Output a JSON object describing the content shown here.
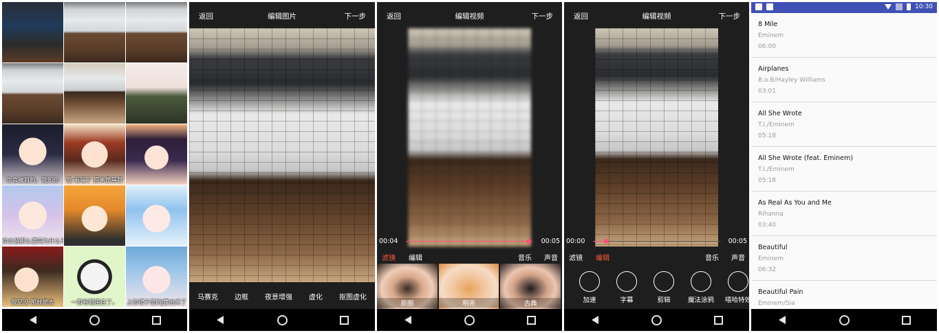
{
  "gallery": {
    "tiles": [
      {
        "style": "code",
        "caption": ""
      },
      {
        "style": "kb",
        "caption": ""
      },
      {
        "style": "kb",
        "caption": ""
      },
      {
        "style": "kb",
        "caption": ""
      },
      {
        "style": "kb2",
        "caption": ""
      },
      {
        "style": "soldiers",
        "caption": ""
      },
      {
        "style": "an-blue",
        "caption": "你会被目的，我知你 "
      },
      {
        "style": "an-red",
        "caption": "我 着福了 原来是基督"
      },
      {
        "style": "an-purple",
        "caption": ""
      },
      {
        "style": "an-pink",
        "caption": "你女装那么漂亮为什么不去"
      },
      {
        "style": "an-orange",
        "caption": ""
      },
      {
        "style": "an-rem",
        "caption": ""
      },
      {
        "style": "an-red2",
        "caption": "我见没 那就是去"
      },
      {
        "style": "panda",
        "caption": "一群智弱围住了。"
      },
      {
        "style": "an-blue2",
        "caption": "上你裙子里的j露出来了"
      }
    ]
  },
  "photo_editor": {
    "back": "返回",
    "title": "编辑图片",
    "next": "下一步",
    "tools": [
      "马赛克",
      "边框",
      "夜景增强",
      "虚化",
      "抠图虚化"
    ]
  },
  "video_filter": {
    "back": "返回",
    "title": "编辑视频",
    "next": "下一步",
    "time_current": "00:04",
    "time_total": "00:05",
    "progress": 0.96,
    "tabs": {
      "filter": "滤镜",
      "edit": "编辑",
      "music": "音乐",
      "sound": "声音"
    },
    "filters": [
      "原图",
      "明亮",
      "古典"
    ]
  },
  "video_edit": {
    "back": "返回",
    "title": "编辑视频",
    "next": "下一步",
    "time_current": "00:00",
    "time_total": "00:05",
    "progress": 0.1,
    "tabs": {
      "filter": "滤镜",
      "edit": "编辑",
      "music": "音乐",
      "sound": "声音"
    },
    "effects": [
      "加速",
      "字幕",
      "剪辑",
      "魔法涂鸦",
      "嘻哈特效"
    ]
  },
  "music_list": {
    "status_time": "10:30",
    "songs": [
      {
        "title": "8 Mile",
        "artist": "Eminem",
        "duration": "06:00"
      },
      {
        "title": "Airplanes",
        "artist": "B.o.B/Hayley Williams",
        "duration": "03:01"
      },
      {
        "title": "All She Wrote",
        "artist": "T.I./Eminem",
        "duration": "05:18"
      },
      {
        "title": "All She Wrote (feat. Eminem)",
        "artist": "T.I./Eminem",
        "duration": "05:18"
      },
      {
        "title": "As Real As You and Me",
        "artist": "Rihanna",
        "duration": "03:40"
      },
      {
        "title": "Beautiful",
        "artist": "Eminem",
        "duration": "06:32"
      },
      {
        "title": "Beautiful Pain",
        "artist": "Eminem/Sia",
        "duration": ""
      }
    ]
  }
}
